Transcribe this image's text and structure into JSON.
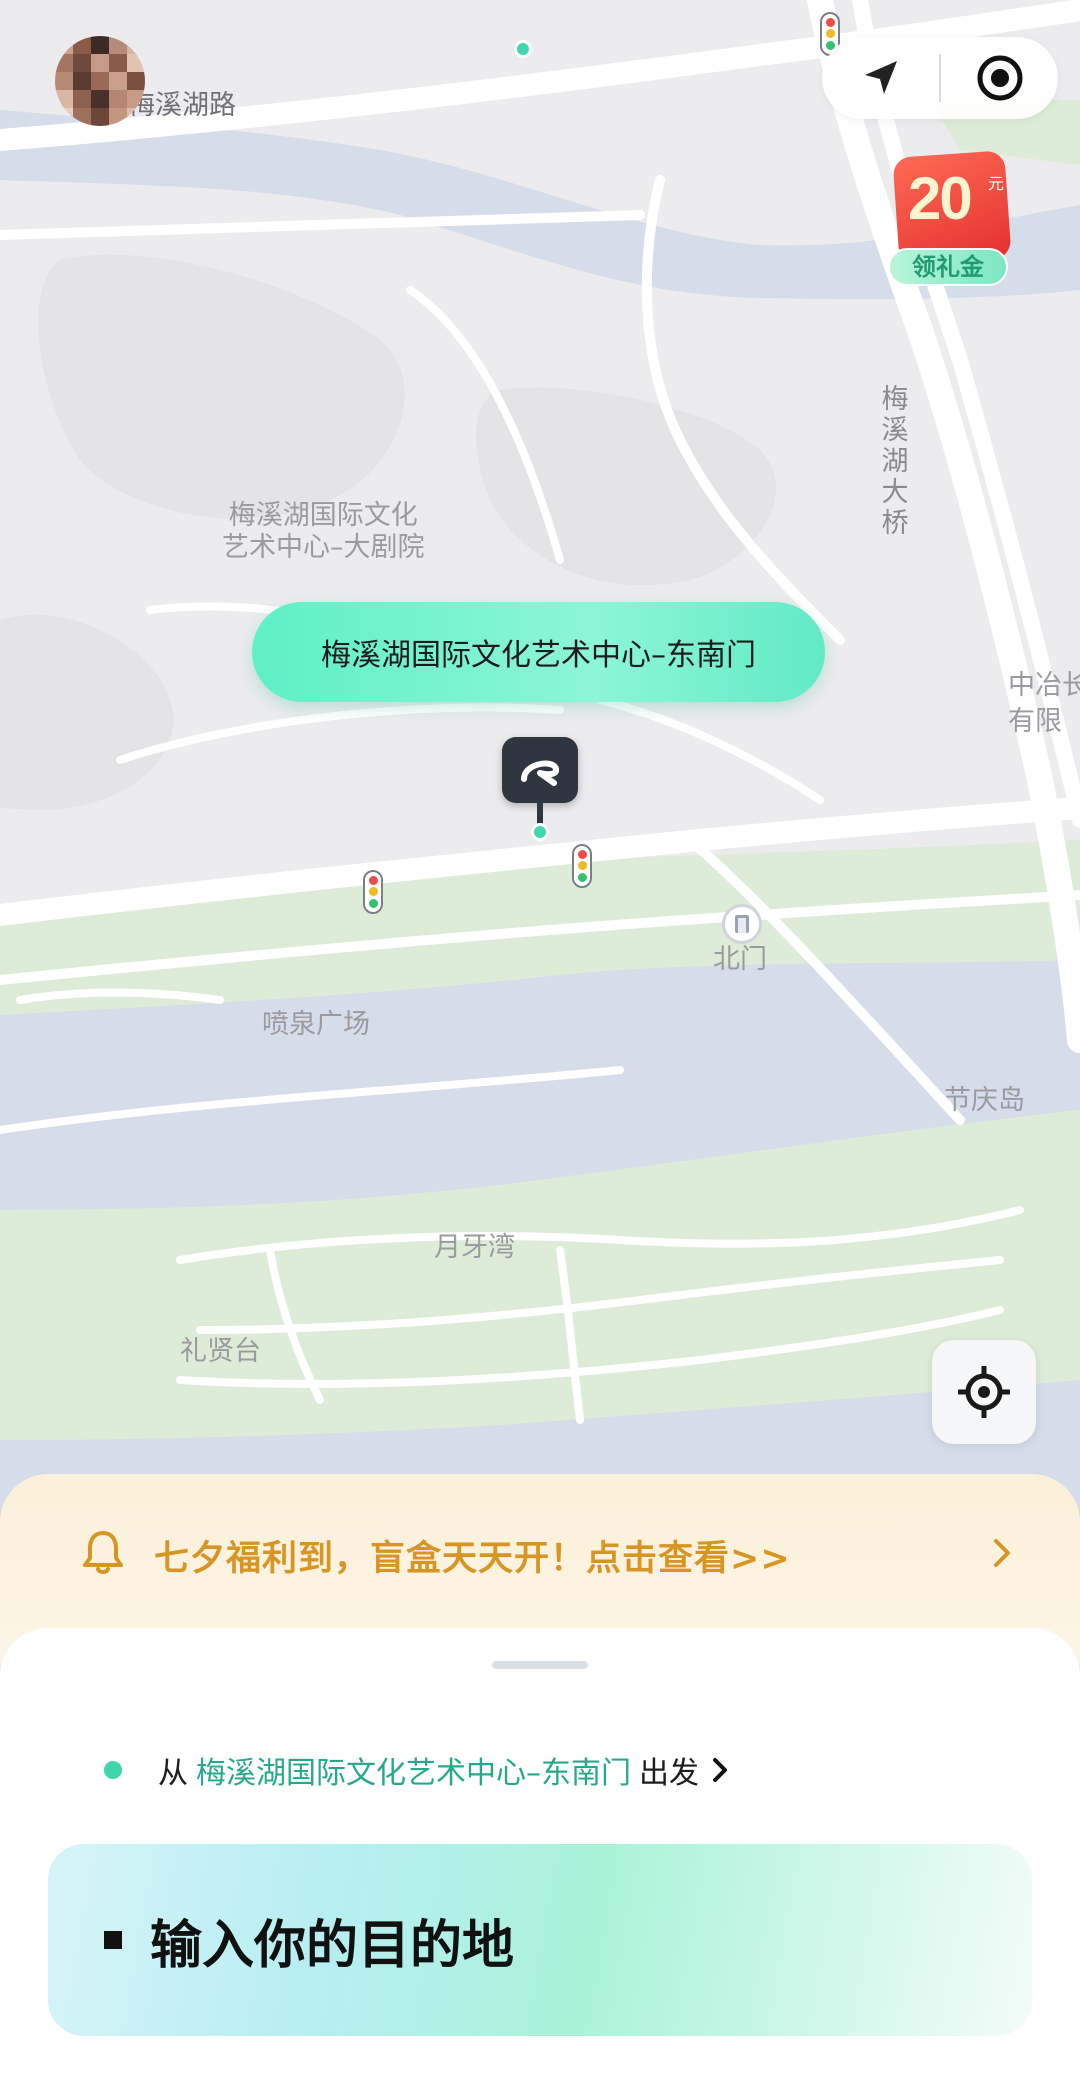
{
  "top_controls": {
    "navigate_icon": "navigation-arrow-icon",
    "record_icon": "target-record-icon"
  },
  "gift_badge": {
    "amount": "20",
    "unit": "元",
    "label": "领礼金",
    "color": "#e3312d"
  },
  "map": {
    "labels": {
      "road_meixihu": "梅溪湖路",
      "theater_line1": "梅溪湖国际文化",
      "theater_line2": "艺术中心–大剧院",
      "bridge": "梅溪湖大桥",
      "metallurgy_line1": "中冶长",
      "metallurgy_line2": "有限",
      "north_gate": "北门",
      "fountain_square": "喷泉广场",
      "festival_island": "节庆岛",
      "crescent_bay": "月牙湾",
      "ceremony_terrace": "礼贤台"
    },
    "pickup_point": "梅溪湖国际文化艺术中心–东南门",
    "colors": {
      "water": "#d5dcea",
      "green": "#dcecd6",
      "land": "#ececee",
      "accent": "#3fd8ae"
    }
  },
  "promo": {
    "icon": "bell-icon",
    "text": "七夕福利到，盲盒天天开！点击查看>>",
    "color": "#d89524"
  },
  "origin": {
    "prefix": "从",
    "place": "梅溪湖国际文化艺术中心–东南门",
    "suffix": "出发"
  },
  "destination": {
    "placeholder": "输入你的目的地"
  }
}
